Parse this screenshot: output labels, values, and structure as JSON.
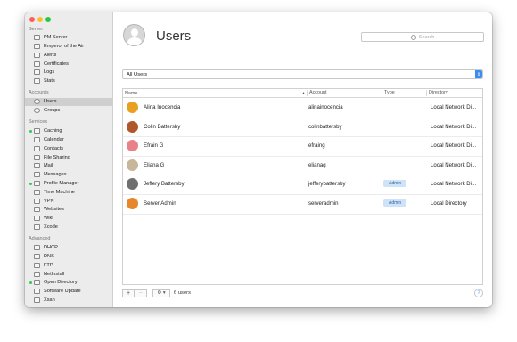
{
  "sidebar": {
    "server_title": "Server",
    "server_items": [
      {
        "label": "PM Server",
        "icon": "server-icon"
      },
      {
        "label": "Emperor of the Air",
        "icon": "server-icon"
      },
      {
        "label": "Alerts",
        "icon": "alerts-icon"
      },
      {
        "label": "Certificates",
        "icon": "certificate-icon"
      },
      {
        "label": "Logs",
        "icon": "logs-icon"
      },
      {
        "label": "Stats",
        "icon": "stats-icon"
      }
    ],
    "accounts_title": "Accounts",
    "accounts_items": [
      {
        "label": "Users",
        "icon": "user-icon",
        "selected": true
      },
      {
        "label": "Groups",
        "icon": "group-icon"
      }
    ],
    "services_title": "Services",
    "services_items": [
      {
        "label": "Caching",
        "icon": "caching-icon",
        "active": true
      },
      {
        "label": "Calendar",
        "icon": "calendar-icon"
      },
      {
        "label": "Contacts",
        "icon": "contacts-icon"
      },
      {
        "label": "File Sharing",
        "icon": "file-sharing-icon"
      },
      {
        "label": "Mail",
        "icon": "mail-icon"
      },
      {
        "label": "Messages",
        "icon": "messages-icon"
      },
      {
        "label": "Profile Manager",
        "icon": "profile-manager-icon",
        "active": true
      },
      {
        "label": "Time Machine",
        "icon": "time-machine-icon"
      },
      {
        "label": "VPN",
        "icon": "vpn-icon"
      },
      {
        "label": "Websites",
        "icon": "websites-icon"
      },
      {
        "label": "Wiki",
        "icon": "wiki-icon"
      },
      {
        "label": "Xcode",
        "icon": "xcode-icon"
      }
    ],
    "advanced_title": "Advanced",
    "advanced_items": [
      {
        "label": "DHCP",
        "icon": "dhcp-icon"
      },
      {
        "label": "DNS",
        "icon": "dns-icon"
      },
      {
        "label": "FTP",
        "icon": "ftp-icon"
      },
      {
        "label": "NetInstall",
        "icon": "netinstall-icon"
      },
      {
        "label": "Open Directory",
        "icon": "open-directory-icon",
        "active": true
      },
      {
        "label": "Software Update",
        "icon": "software-update-icon"
      },
      {
        "label": "Xsan",
        "icon": "xsan-icon"
      }
    ]
  },
  "main": {
    "title": "Users",
    "search_placeholder": "Search",
    "filter_value": "All Users",
    "columns": {
      "name": "Name",
      "account": "Account",
      "type": "Type",
      "directory": "Directory"
    },
    "rows": [
      {
        "name": "Alina Inocencia",
        "account": "alinainocencia",
        "type": "",
        "directory": "Local Network Di...",
        "avatar_color": "#e7a020"
      },
      {
        "name": "Colin Battersby",
        "account": "colinbattersby",
        "type": "",
        "directory": "Local Network Di...",
        "avatar_color": "#b0572b"
      },
      {
        "name": "Efrain G",
        "account": "efraing",
        "type": "",
        "directory": "Local Network Di...",
        "avatar_color": "#e9818a"
      },
      {
        "name": "Eliana G",
        "account": "elianag",
        "type": "",
        "directory": "Local Network Di...",
        "avatar_color": "#c7b69a"
      },
      {
        "name": "Jeffery Battersby",
        "account": "jefferybattersby",
        "type": "Admin",
        "directory": "Local Network Di...",
        "avatar_color": "#6f6f6f"
      },
      {
        "name": "Server Admin",
        "account": "serveradmin",
        "type": "Admin",
        "directory": "Local Directory",
        "avatar_color": "#e5872a"
      }
    ],
    "footer": {
      "add": "+",
      "remove": "−",
      "gear": "⚙ ▾",
      "count": "6 users",
      "help": "?"
    }
  },
  "colors": {
    "accent": "#3d8cf0",
    "active_dot": "#35c759",
    "admin_badge": "#cfe3f8"
  }
}
